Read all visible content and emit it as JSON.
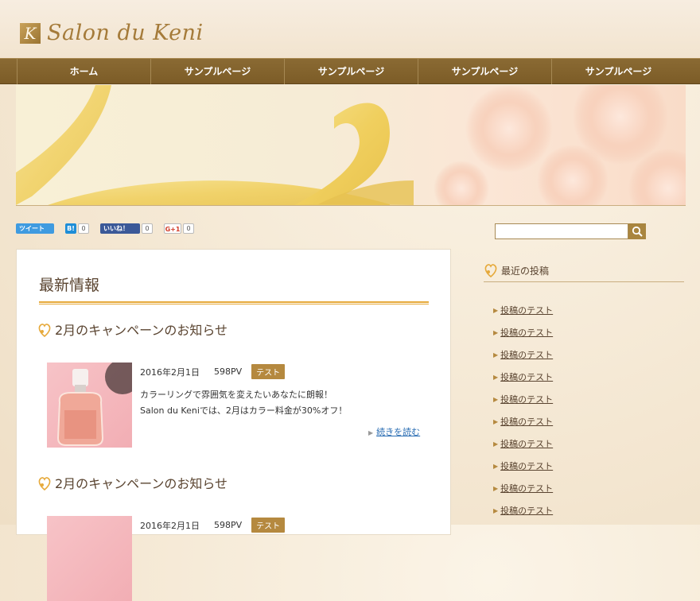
{
  "site": {
    "logo_mark": "K",
    "title": "Salon du Keni"
  },
  "nav": {
    "items": [
      "ホーム",
      "サンプルページ",
      "サンプルページ",
      "サンプルページ",
      "サンプルページ"
    ]
  },
  "social": {
    "tweet_label": "ツイート",
    "hatena_label": "B!",
    "hatena_count": "0",
    "facebook_label": "いいね！",
    "facebook_count": "0",
    "gplus_label": "G+1",
    "gplus_count": "0"
  },
  "main": {
    "heading": "最新情報",
    "posts": [
      {
        "title": "2月のキャンペーンのお知らせ",
        "date": "2016年2月1日",
        "pv": "598PV",
        "category": "テスト",
        "excerpt_line1": "カラーリングで雰囲気を変えたいあなたに朗報！",
        "excerpt_line2": "Salon du Keniでは、2月はカラー料金が30%オフ！",
        "more": "続きを読む"
      },
      {
        "title": "2月のキャンペーンのお知らせ",
        "date": "2016年2月1日",
        "pv": "598PV",
        "category": "テスト"
      }
    ]
  },
  "sidebar": {
    "heading": "最近の投稿",
    "items": [
      "投稿のテスト",
      "投稿のテスト",
      "投稿のテスト",
      "投稿のテスト",
      "投稿のテスト",
      "投稿のテスト",
      "投稿のテスト",
      "投稿のテスト",
      "投稿のテスト",
      "投稿のテスト"
    ]
  },
  "colors": {
    "nav_bg": "#7c5c27",
    "accent": "#b5893f",
    "rule": "#e6a93a",
    "link": "#2a6db3"
  }
}
